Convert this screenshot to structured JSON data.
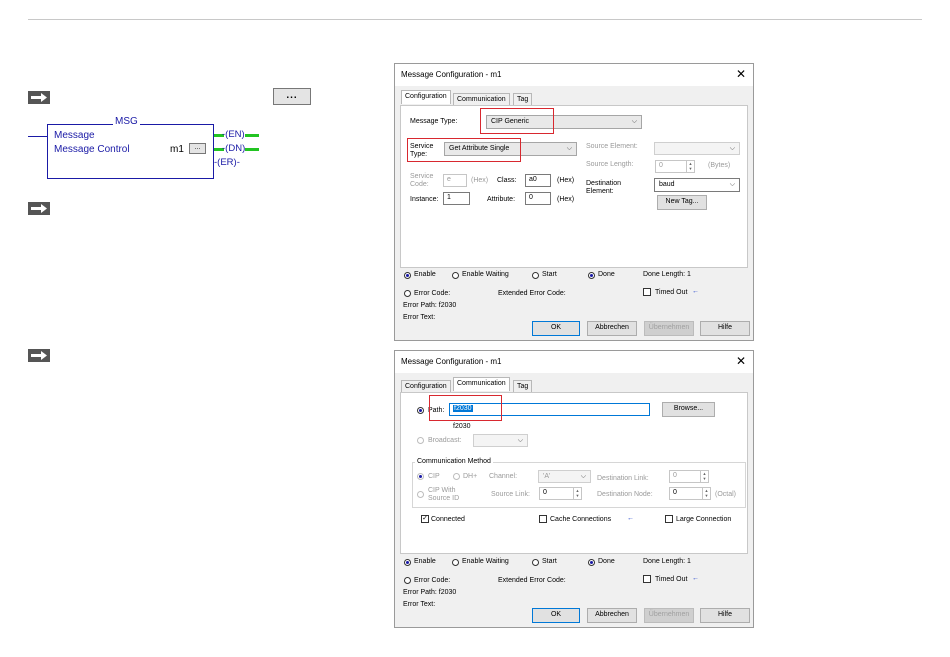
{
  "ladder": {
    "instruction": "MSG",
    "label1": "Message",
    "label2": "Message Control",
    "tag": "m1",
    "small_ellipsis": "...",
    "ellipsis_button": "...",
    "outputs": [
      "EN",
      "DN",
      "ER"
    ]
  },
  "dialog1": {
    "title": "Message Configuration - m1",
    "close": "✕",
    "tabs": [
      "Configuration",
      "Communication",
      "Tag"
    ],
    "message_type_label": "Message Type:",
    "message_type_value": "CIP Generic",
    "service_type_label": "Service Type:",
    "service_type_value": "Get Attribute Single",
    "service_code_label": "Service Code:",
    "service_code_value": "e",
    "hex": "(Hex)",
    "class_label": "Class:",
    "class_value": "a0",
    "instance_label": "Instance:",
    "instance_value": "1",
    "attribute_label": "Attribute:",
    "attribute_value": "0",
    "source_element_label": "Source Element:",
    "source_length_label": "Source Length:",
    "source_length_value": "0",
    "bytes": "(Bytes)",
    "destination_label": "Destination Element:",
    "destination_value": "baud",
    "new_tag": "New Tag...",
    "status": {
      "enable": "Enable",
      "enable_waiting": "Enable Waiting",
      "start": "Start",
      "done": "Done",
      "done_length": "Done Length: 1",
      "error_code": "Error Code:",
      "extended_error": "Extended Error Code:",
      "timed_out": "Timed Out",
      "error_path": "Error Path: f2030",
      "error_text": "Error Text:"
    },
    "buttons": {
      "ok": "OK",
      "cancel": "Abbrechen",
      "apply": "Übernehmen",
      "help": "Hilfe"
    }
  },
  "dialog2": {
    "title": "Message Configuration - m1",
    "close": "✕",
    "tabs": [
      "Configuration",
      "Communication",
      "Tag"
    ],
    "path_label": "Path:",
    "path_value": "f2030",
    "path_display": "f2030",
    "browse": "Browse...",
    "broadcast_label": "Broadcast:",
    "comm_method_label": "Communication Method",
    "cip": "CIP",
    "dhplus": "DH+",
    "channel_label": "Channel:",
    "channel_value": "'A'",
    "dest_link_label": "Destination Link:",
    "dest_link_value": "0",
    "cip_source_label": "CIP With Source ID",
    "source_link_label": "Source Link:",
    "source_link_value": "0",
    "dest_node_label": "Destination Node:",
    "dest_node_value": "0",
    "octal": "(Octal)",
    "connected": "Connected",
    "cache": "Cache Connections",
    "large": "Large Connection",
    "status": {
      "enable": "Enable",
      "enable_waiting": "Enable Waiting",
      "start": "Start",
      "done": "Done",
      "done_length": "Done Length: 1",
      "error_code": "Error Code:",
      "extended_error": "Extended Error Code:",
      "timed_out": "Timed Out",
      "error_path": "Error Path: f2030",
      "error_text": "Error Text:"
    },
    "buttons": {
      "ok": "OK",
      "cancel": "Abbrechen",
      "apply": "Übernehmen",
      "help": "Hilfe"
    }
  },
  "colors": {
    "ladder_blue": "#1a1aa6",
    "highlight_red": "#d8282f",
    "contact_green": "#22c422"
  }
}
